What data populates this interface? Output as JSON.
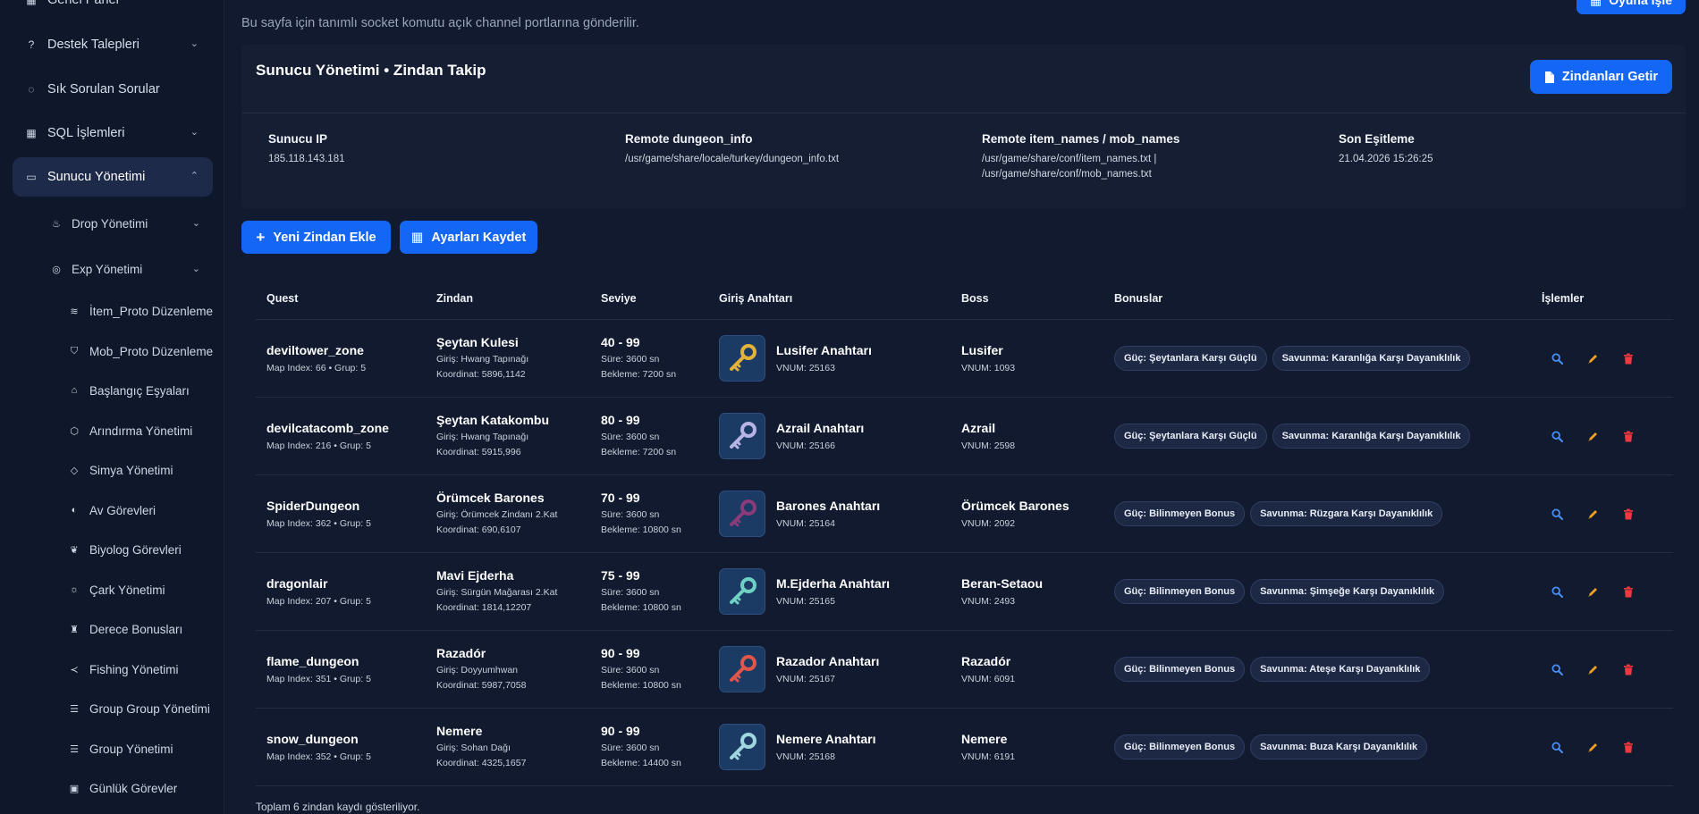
{
  "sidebar": {
    "items": [
      {
        "label": "Genel Panel",
        "icon": "dashboard-icon",
        "glyph": "▦",
        "chevron": ""
      },
      {
        "label": "Destek Talepleri",
        "icon": "help-circle-icon",
        "glyph": "?",
        "chevron": "⌄"
      },
      {
        "label": "Sık Sorulan Sorular",
        "icon": "question-icon",
        "glyph": "◌",
        "chevron": ""
      },
      {
        "label": "SQL İşlemleri",
        "icon": "grid-icon",
        "glyph": "▦",
        "chevron": "⌄"
      },
      {
        "label": "Sunucu Yönetimi",
        "icon": "monitor-icon",
        "glyph": "▭",
        "chevron": "⌃"
      }
    ],
    "subitems": [
      {
        "label": "Drop Yönetimi",
        "icon": "flame-icon",
        "glyph": "♨",
        "chevron": "⌄"
      },
      {
        "label": "Exp Yönetimi",
        "icon": "bulb-icon",
        "glyph": "◎",
        "chevron": "⌄"
      },
      {
        "label": "İtem_Proto Düzenleme",
        "icon": "layers-icon",
        "glyph": "≋",
        "chevron": ""
      },
      {
        "label": "Mob_Proto Düzenleme",
        "icon": "shield-icon",
        "glyph": "⛉",
        "chevron": ""
      },
      {
        "label": "Başlangıç Eşyaları",
        "icon": "gift-icon",
        "glyph": "⌂",
        "chevron": ""
      },
      {
        "label": "Arındırma Yönetimi",
        "icon": "cube-icon",
        "glyph": "⬡",
        "chevron": ""
      },
      {
        "label": "Simya Yönetimi",
        "icon": "diamond-icon",
        "glyph": "◇",
        "chevron": ""
      },
      {
        "label": "Av Görevleri",
        "icon": "crosshair-icon",
        "glyph": "◐",
        "chevron": ""
      },
      {
        "label": "Biyolog Görevleri",
        "icon": "leaf-icon",
        "glyph": "❦",
        "chevron": ""
      },
      {
        "label": "Çark Yönetimi",
        "icon": "sun-icon",
        "glyph": "☼",
        "chevron": ""
      },
      {
        "label": "Derece Bonusları",
        "icon": "trophy-icon",
        "glyph": "♜",
        "chevron": ""
      },
      {
        "label": "Fishing Yönetimi",
        "icon": "fish-icon",
        "glyph": "≺",
        "chevron": ""
      },
      {
        "label": "Group Group Yönetimi",
        "icon": "list-icon",
        "glyph": "☰",
        "chevron": ""
      },
      {
        "label": "Group Yönetimi",
        "icon": "list-icon",
        "glyph": "☰",
        "chevron": ""
      },
      {
        "label": "Günlük Görevler",
        "icon": "calendar-icon",
        "glyph": "▣",
        "chevron": ""
      }
    ]
  },
  "page": {
    "subtitle": "Bu sayfa için tanımlı socket komutu açık channel portlarına gönderilir.",
    "top_button": "Oyuna İşle"
  },
  "card": {
    "title": "Sunucu Yönetimi • Zindan Takip",
    "fetch_button": "Zindanları Getir",
    "info": [
      {
        "label": "Sunucu IP",
        "value": "185.118.143.181"
      },
      {
        "label": "Remote dungeon_info",
        "value": "/usr/game/share/locale/turkey/dungeon_info.txt"
      },
      {
        "label": "Remote item_names / mob_names",
        "value": "/usr/game/share/conf/item_names.txt | /usr/game/share/conf/mob_names.txt"
      },
      {
        "label": "Son Eşitleme",
        "value": "21.04.2026 15:26:25"
      }
    ]
  },
  "actions": {
    "add_button": "Yeni Zindan Ekle",
    "save_button": "Ayarları Kaydet"
  },
  "table": {
    "headers": {
      "quest": "Quest",
      "dungeon": "Zindan",
      "level": "Seviye",
      "key": "Giriş Anahtarı",
      "boss": "Boss",
      "bonuses": "Bonuslar",
      "actions": "İşlemler"
    },
    "rows": [
      {
        "quest": "deviltower_zone",
        "meta": "Map Index: 66 • Grup: 5",
        "dungeon": "Şeytan Kulesi",
        "entry": "Giriş: Hwang Tapınağı",
        "coord": "Koordinat: 5896,1142",
        "level": "40 - 99",
        "duration": "Süre: 3600 sn",
        "wait": "Bekleme: 7200 sn",
        "key_name": "Lusifer Anahtarı",
        "key_vnum": "VNUM: 25163",
        "key_color": "#e2b23a",
        "boss": "Lusifer",
        "boss_vnum": "VNUM: 1093",
        "bonus1": "Güç: Şeytanlara Karşı Güçlü",
        "bonus2": "Savunma: Karanlığa Karşı Dayanıklılık"
      },
      {
        "quest": "devilcatacomb_zone",
        "meta": "Map Index: 216 • Grup: 5",
        "dungeon": "Şeytan Katakombu",
        "entry": "Giriş: Hwang Tapınağı",
        "coord": "Koordinat: 5915,996",
        "level": "80 - 99",
        "duration": "Süre: 3600 sn",
        "wait": "Bekleme: 7200 sn",
        "key_name": "Azrail Anahtarı",
        "key_vnum": "VNUM: 25166",
        "key_color": "#b8b4e6",
        "boss": "Azrail",
        "boss_vnum": "VNUM: 2598",
        "bonus1": "Güç: Şeytanlara Karşı Güçlü",
        "bonus2": "Savunma: Karanlığa Karşı Dayanıklılık"
      },
      {
        "quest": "SpiderDungeon",
        "meta": "Map Index: 362 • Grup: 5",
        "dungeon": "Örümcek Barones",
        "entry": "Giriş: Örümcek Zindanı 2.Kat",
        "coord": "Koordinat: 690,6107",
        "level": "70 - 99",
        "duration": "Süre: 3600 sn",
        "wait": "Bekleme: 10800 sn",
        "key_name": "Barones Anahtarı",
        "key_vnum": "VNUM: 25164",
        "key_color": "#8a3b7a",
        "boss": "Örümcek Barones",
        "boss_vnum": "VNUM: 2092",
        "bonus1": "Güç: Bilinmeyen Bonus",
        "bonus2": "Savunma: Rüzgara Karşı Dayanıklılık"
      },
      {
        "quest": "dragonlair",
        "meta": "Map Index: 207 • Grup: 5",
        "dungeon": "Mavi Ejderha",
        "entry": "Giriş: Sürgün Mağarası 2.Kat",
        "coord": "Koordinat: 1814,12207",
        "level": "75 - 99",
        "duration": "Süre: 3600 sn",
        "wait": "Bekleme: 10800 sn",
        "key_name": "M.Ejderha Anahtarı",
        "key_vnum": "VNUM: 25165",
        "key_color": "#6fd0c4",
        "boss": "Beran-Setaou",
        "boss_vnum": "VNUM: 2493",
        "bonus1": "Güç: Bilinmeyen Bonus",
        "bonus2": "Savunma: Şimşeğe Karşı Dayanıklılık"
      },
      {
        "quest": "flame_dungeon",
        "meta": "Map Index: 351 • Grup: 5",
        "dungeon": "Razadór",
        "entry": "Giriş: Doyyumhwan",
        "coord": "Koordinat: 5987,7058",
        "level": "90 - 99",
        "duration": "Süre: 3600 sn",
        "wait": "Bekleme: 10800 sn",
        "key_name": "Razador Anahtarı",
        "key_vnum": "VNUM: 25167",
        "key_color": "#e0564a",
        "boss": "Razadór",
        "boss_vnum": "VNUM: 6091",
        "bonus1": "Güç: Bilinmeyen Bonus",
        "bonus2": "Savunma: Ateşe Karşı Dayanıklılık"
      },
      {
        "quest": "snow_dungeon",
        "meta": "Map Index: 352 • Grup: 5",
        "dungeon": "Nemere",
        "entry": "Giriş: Sohan Dağı",
        "coord": "Koordinat: 4325,1657",
        "level": "90 - 99",
        "duration": "Süre: 3600 sn",
        "wait": "Bekleme: 14400 sn",
        "key_name": "Nemere Anahtarı",
        "key_vnum": "VNUM: 25168",
        "key_color": "#9fd6e0",
        "boss": "Nemere",
        "boss_vnum": "VNUM: 6191",
        "bonus1": "Güç: Bilinmeyen Bonus",
        "bonus2": "Savunma: Buza Karşı Dayanıklılık"
      }
    ],
    "footer": "Toplam 6 zindan kaydı gösteriliyor."
  },
  "colors": {
    "accent": "#1467f4",
    "view": "#4a8ff5",
    "edit": "#f0a020",
    "delete": "#f0383f"
  }
}
